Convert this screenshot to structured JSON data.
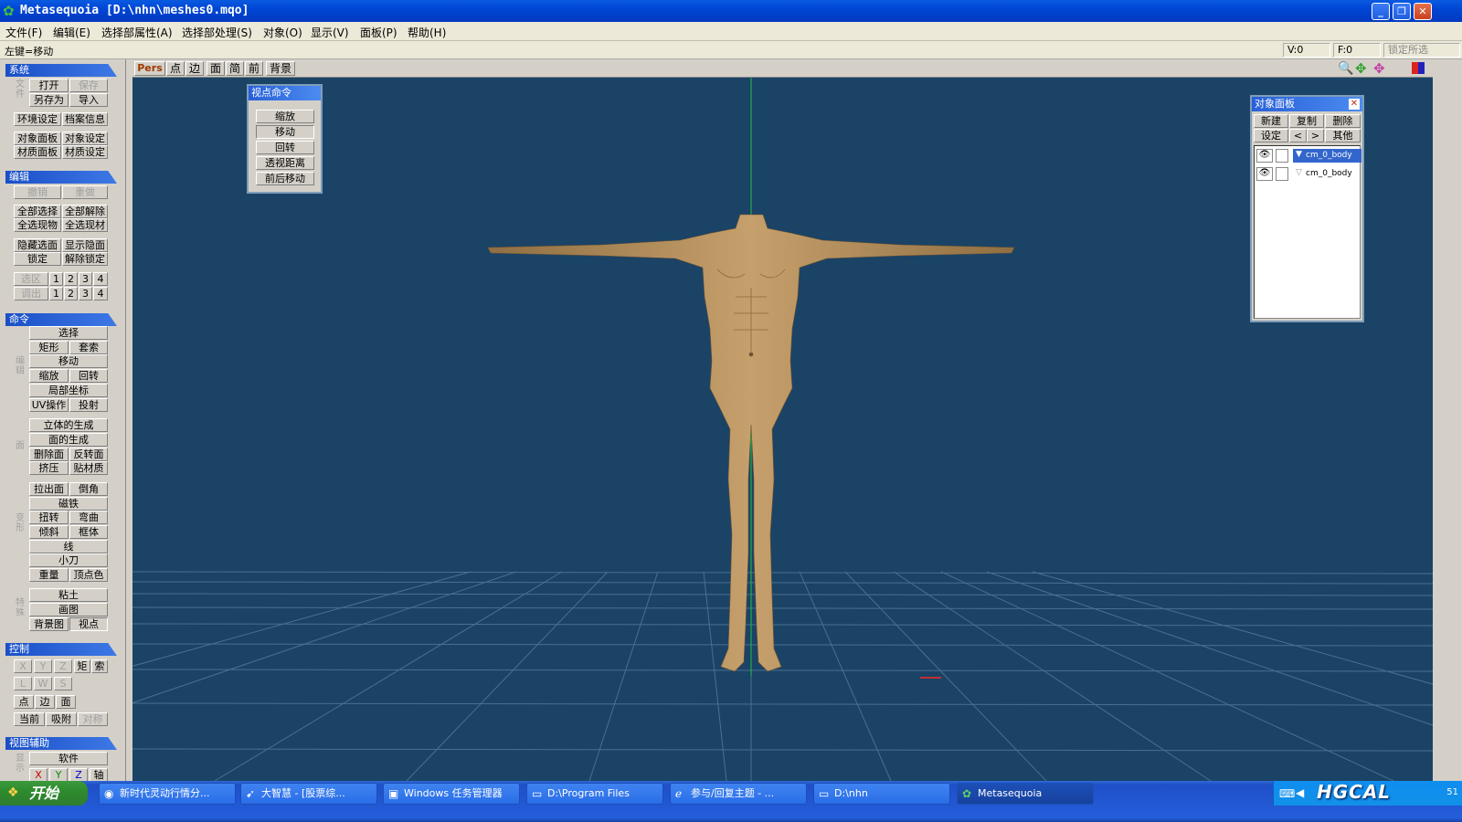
{
  "window": {
    "title": "Metasequoia [D:\\nhn\\meshes0.mqo]"
  },
  "menu": [
    "文件(F)",
    "编辑(E)",
    "选择部属性(A)",
    "选择部处理(S)",
    "对象(O)",
    "显示(V)",
    "面板(P)",
    "帮助(H)"
  ],
  "status": {
    "hint": "左键=移动",
    "v_count": "V:0",
    "f_count": "F:0",
    "lock_label": "锁定所选"
  },
  "left": {
    "system": {
      "title": "系统",
      "open": "打开",
      "save": "保存",
      "saveas": "另存为",
      "import": "导入",
      "env": "环境设定",
      "docinfo": "档案信息",
      "objpanel": "对象面板",
      "objset": "对象设定",
      "matpanel": "材质面板",
      "matset": "材质设定",
      "side_a": "文件"
    },
    "edit": {
      "title": "编辑",
      "undo": "撤销",
      "redo": "重做",
      "selall": "全部选择",
      "deselall": "全部解除",
      "selobj": "全选现物",
      "selmat": "全选现材",
      "hide": "隐藏选面",
      "showhide": "显示隐面",
      "lock": "锁定",
      "unlock": "解除锁定",
      "selzone": "选区",
      "callout": "调出",
      "nums": [
        "1",
        "2",
        "3",
        "4"
      ]
    },
    "cmd": {
      "title": "命令",
      "select": "选择",
      "rect": "矩形",
      "lasso": "套索",
      "move": "移动",
      "scale": "缩放",
      "rotate": "回转",
      "local": "局部坐标",
      "uvop": "UV操作",
      "project": "投射",
      "solid": "立体的生成",
      "face": "面的生成",
      "delface": "删除面",
      "flipface": "反转面",
      "extrude": "挤压",
      "pastemat": "贴材质",
      "pullface": "拉出面",
      "bevel": "倒角",
      "magnet": "磁铁",
      "twist": "扭转",
      "bend": "弯曲",
      "tilt": "倾斜",
      "lattice": "框体",
      "line": "线",
      "knife": "小刀",
      "weight": "重量",
      "vcolor": "顶点色",
      "clay": "粘土",
      "paint": "画图",
      "bgimg": "背景图",
      "view": "视点",
      "side_edit": "编辑",
      "side_face": "面",
      "side_deform": "变形",
      "side_other": "特殊"
    },
    "ctrl": {
      "title": "控制",
      "x": "X",
      "y": "Y",
      "z": "Z",
      "rect": "矩",
      "lasso": "索",
      "l": "L",
      "w": "W",
      "s": "S",
      "pt": "点",
      "edge": "边",
      "face": "面",
      "current": "当前",
      "snap": "吸附",
      "sym": "对称"
    },
    "viewaid": {
      "title": "视图辅助",
      "soft": "软件",
      "x": "X",
      "y": "Y",
      "z": "Z",
      "axis": "轴",
      "side": "显示"
    }
  },
  "viewport_toolbar": {
    "pers": "Pers",
    "pt": "点",
    "edge": "边",
    "face": "面",
    "simple": "简",
    "front": "前",
    "bg": "背景"
  },
  "view_cmd": {
    "title": "视点命令",
    "items": [
      "缩放",
      "移动",
      "回转",
      "透视距离",
      "前后移动"
    ]
  },
  "obj_panel": {
    "title": "对象面板",
    "new": "新建",
    "copy": "复制",
    "del": "删除",
    "set": "设定",
    "prev": "<",
    "next": ">",
    "other": "其他",
    "objects": [
      "cm_0_body",
      "cm_0_body"
    ]
  },
  "taskbar": {
    "start": "开始",
    "tasks": [
      "新时代灵动行情分...",
      "大智慧 - [股票综...",
      "Windows 任务管理器",
      "D:\\Program Files",
      "参与/回复主题 - ...",
      "D:\\nhn",
      "Metasequoia"
    ],
    "tray_logo": "HGCAL",
    "clock": "51"
  },
  "colors": {
    "viewport_bg": "#1b4366",
    "skin": "#b7935f",
    "accent": "#1a4fc7"
  }
}
